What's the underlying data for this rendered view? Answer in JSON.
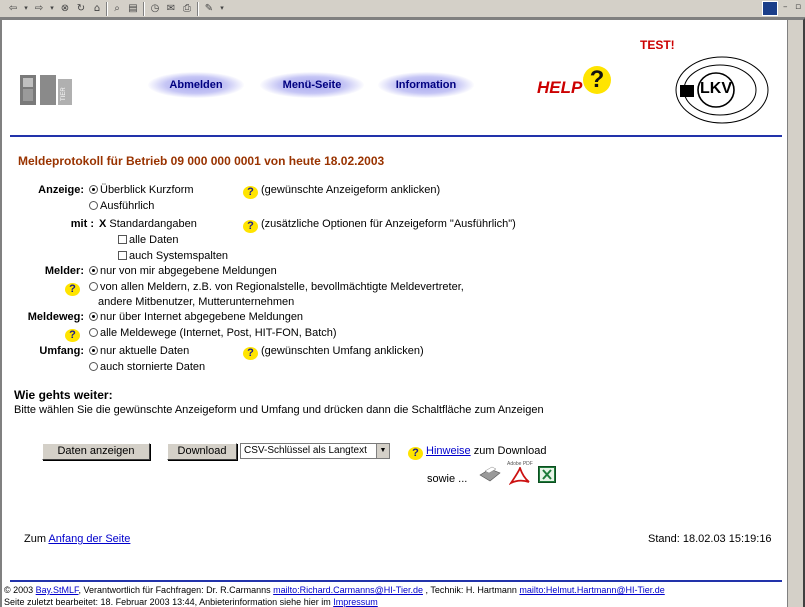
{
  "toolbar": {
    "icons": [
      "back-arrow-icon",
      "forward-arrow-icon",
      "stop-icon",
      "refresh-icon",
      "home-icon",
      "search-icon",
      "favorites-icon",
      "history-icon",
      "mail-icon",
      "print-icon",
      "edit-icon"
    ]
  },
  "header": {
    "test_label": "TEST!",
    "nav": {
      "abmelden": "Abmelden",
      "menu": "Menü-Seite",
      "info": "Information"
    },
    "help_logo": "HELP",
    "lkv_logo": "LKV"
  },
  "page_title": "Meldeprotokoll für Betrieb 09 000 000 0001 von heute 18.02.2003",
  "form": {
    "anzeige": {
      "label": "Anzeige:",
      "options": [
        "Überblick Kurzform",
        "Ausführlich"
      ],
      "selected": 0,
      "hint": "(gewünschte Anzeigeform anklicken)"
    },
    "mit": {
      "label": "mit :",
      "marker": "X",
      "standard": "Standardangaben",
      "hint": "(zusätzliche Optionen für Anzeigeform \"Ausführlich\")",
      "options": [
        "alle Daten",
        "auch Systemspalten"
      ]
    },
    "melder": {
      "label": "Melder:",
      "options": [
        "nur von mir abgegebene Meldungen",
        "von allen Meldern, z.B. von Regionalstelle, bevollmächtigte Meldevertreter,"
      ],
      "option2_cont": "andere Mitbenutzer, Mutterunternehmen",
      "selected": 0
    },
    "meldeweg": {
      "label": "Meldeweg:",
      "options": [
        "nur über Internet abgegebene Meldungen",
        "alle Meldewege (Internet, Post, HIT-FON, Batch)"
      ],
      "selected": 0
    },
    "umfang": {
      "label": "Umfang:",
      "options": [
        "nur aktuelle Daten",
        "auch stornierte Daten"
      ],
      "selected": 0,
      "hint": "(gewünschten Umfang anklicken)"
    }
  },
  "next": {
    "heading": "Wie gehts weiter:",
    "text": "Bitte wählen Sie die gewünschte Anzeigeform und Umfang und drücken dann die Schaltfläche zum Anzeigen"
  },
  "actions": {
    "show_button": "Daten anzeigen",
    "download_button": "Download",
    "format_select": "CSV-Schlüssel als Langtext",
    "hinweise_link": "Hinweise",
    "hinweise_suffix": "zum Download",
    "sowie": "sowie ...",
    "pdf_label": "Adobe PDF"
  },
  "bottom": {
    "zum": "Zum",
    "top_link": "Anfang der Seite",
    "stand": "Stand: 18.02.03 15:19:16"
  },
  "footer": {
    "copyright": "© 2003",
    "org_link": "Bay.StMLF",
    "resp": ", Verantwortlich für Fachfragen: Dr. R.Carmanns",
    "mail1": "mailto:Richard.Carmanns@HI-Tier.de",
    "tech": ", Technik: H. Hartmann",
    "mail2": "mailto:Helmut.Hartmann@HI-Tier.de",
    "line2": "Seite zuletzt bearbeitet: 18. Februar 2003 13:44, Anbieterinformation siehe hier im",
    "impressum": "Impressum"
  },
  "colors": {
    "title": "#993300",
    "rule": "#2233aa",
    "link": "#0000cc",
    "help_yellow": "#ffe400",
    "test_red": "#cc0000"
  }
}
